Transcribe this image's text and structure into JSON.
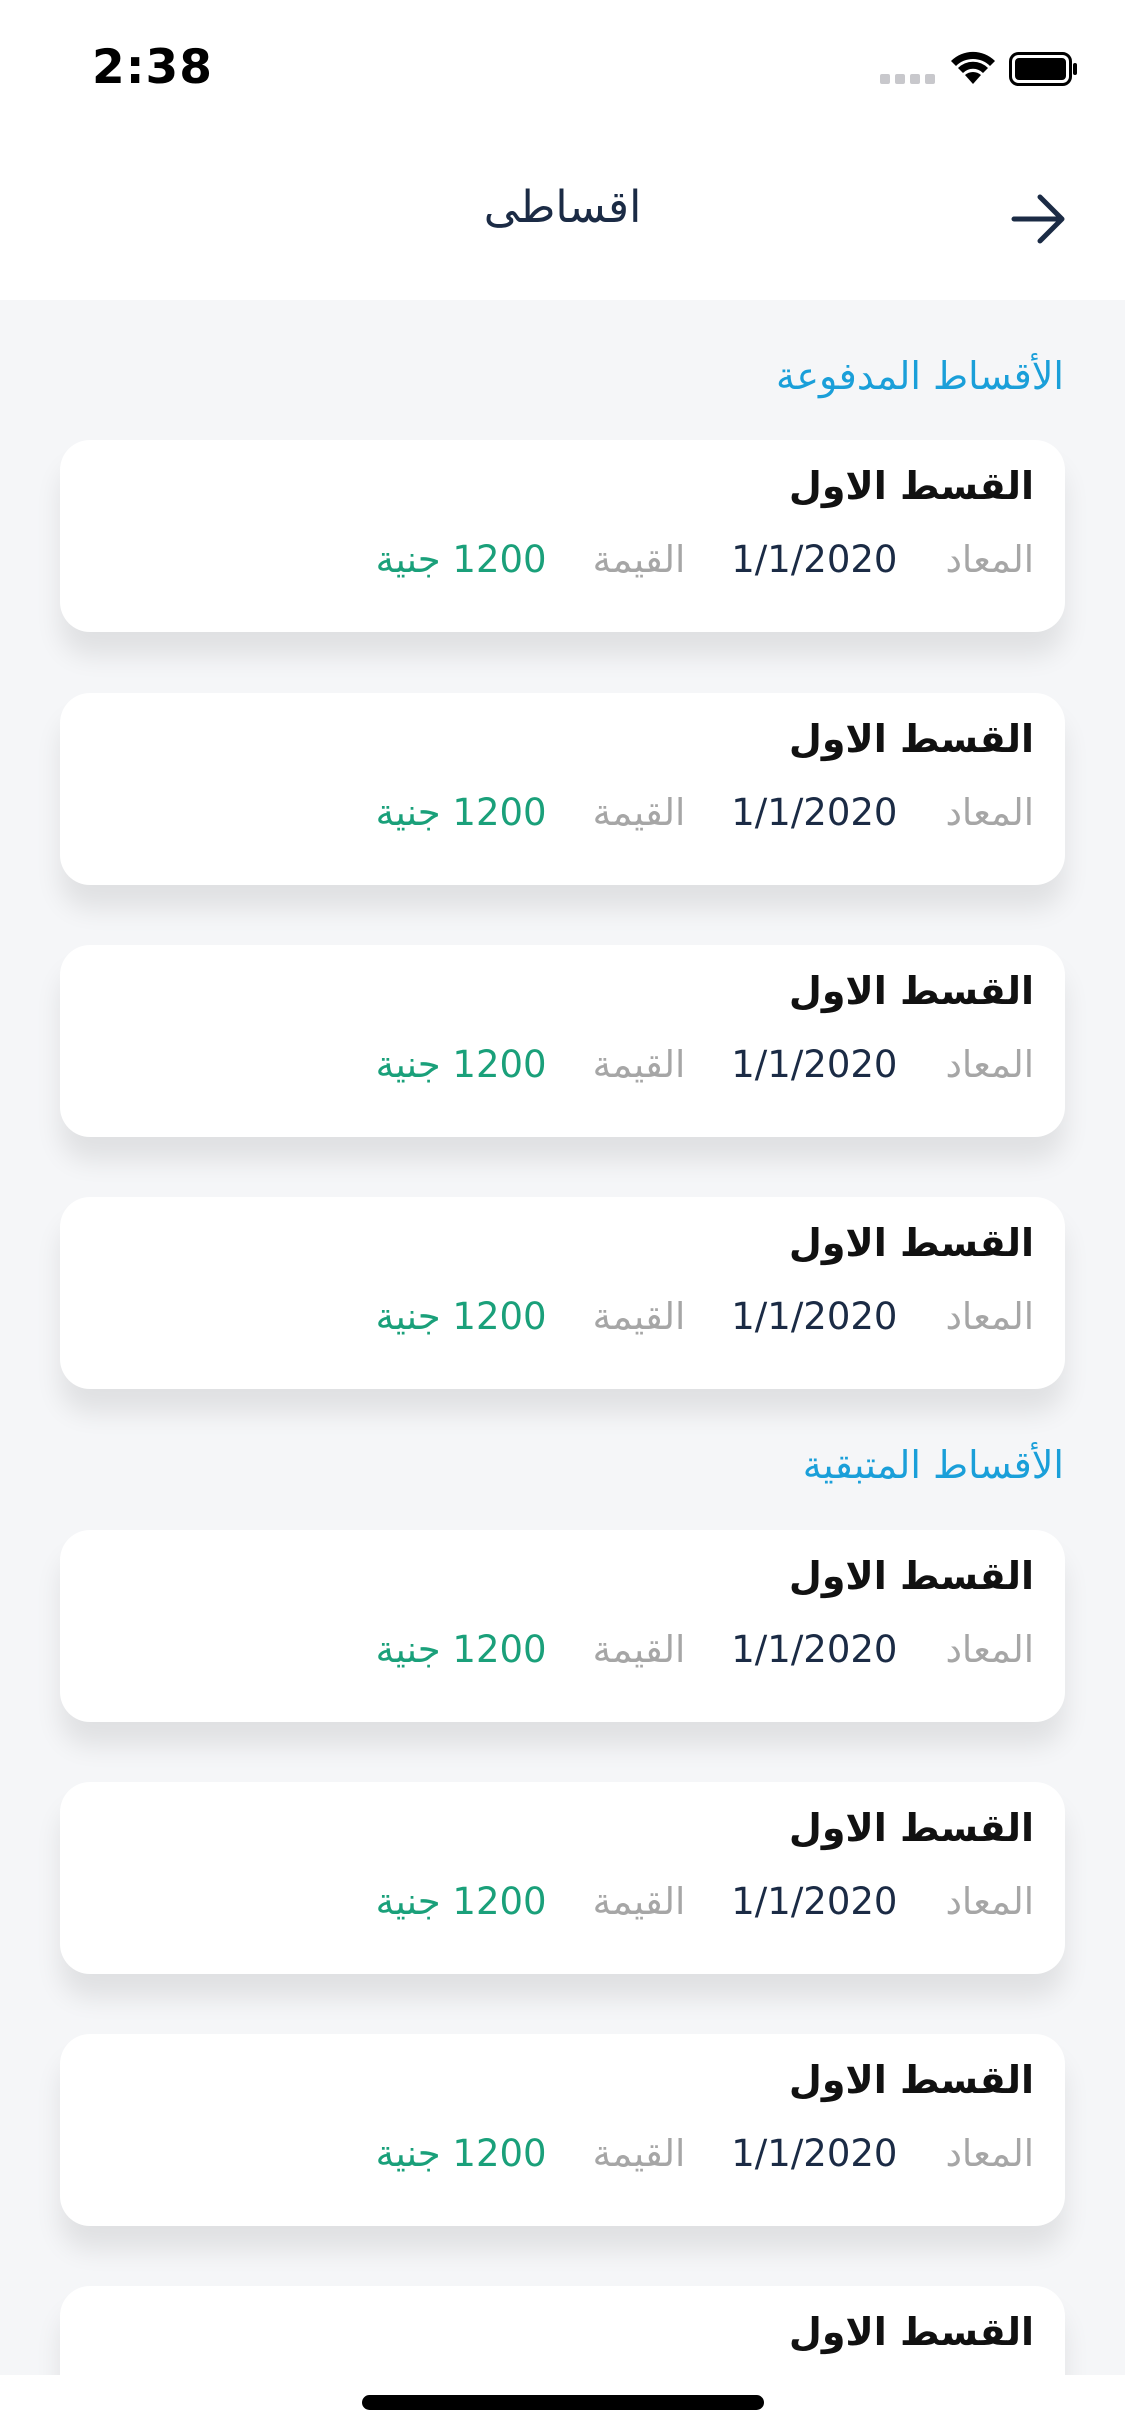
{
  "status_bar": {
    "time": "2:38"
  },
  "nav": {
    "title": "اقساطى",
    "back_icon": "arrow-right-icon"
  },
  "sections": [
    {
      "title": "الأقساط المدفوعة"
    },
    {
      "title": "الأقساط المتبقية"
    }
  ],
  "labels": {
    "due": "المعاد",
    "value": "القيمة"
  },
  "paid_installments": [
    {
      "title": "القسط الاول",
      "date": "1/1/2020",
      "amount": "1200 جنية"
    },
    {
      "title": "القسط الاول",
      "date": "1/1/2020",
      "amount": "1200 جنية"
    },
    {
      "title": "القسط الاول",
      "date": "1/1/2020",
      "amount": "1200 جنية"
    },
    {
      "title": "القسط الاول",
      "date": "1/1/2020",
      "amount": "1200 جنية"
    }
  ],
  "remaining_installments": [
    {
      "title": "القسط الاول",
      "date": "1/1/2020",
      "amount": "1200 جنية"
    },
    {
      "title": "القسط الاول",
      "date": "1/1/2020",
      "amount": "1200 جنية"
    },
    {
      "title": "القسط الاول",
      "date": "1/1/2020",
      "amount": "1200 جنية"
    },
    {
      "title": "القسط الاول"
    }
  ],
  "colors": {
    "accent": "#1a9fd9",
    "amount": "#1aa07a",
    "title": "#1b2b45"
  }
}
